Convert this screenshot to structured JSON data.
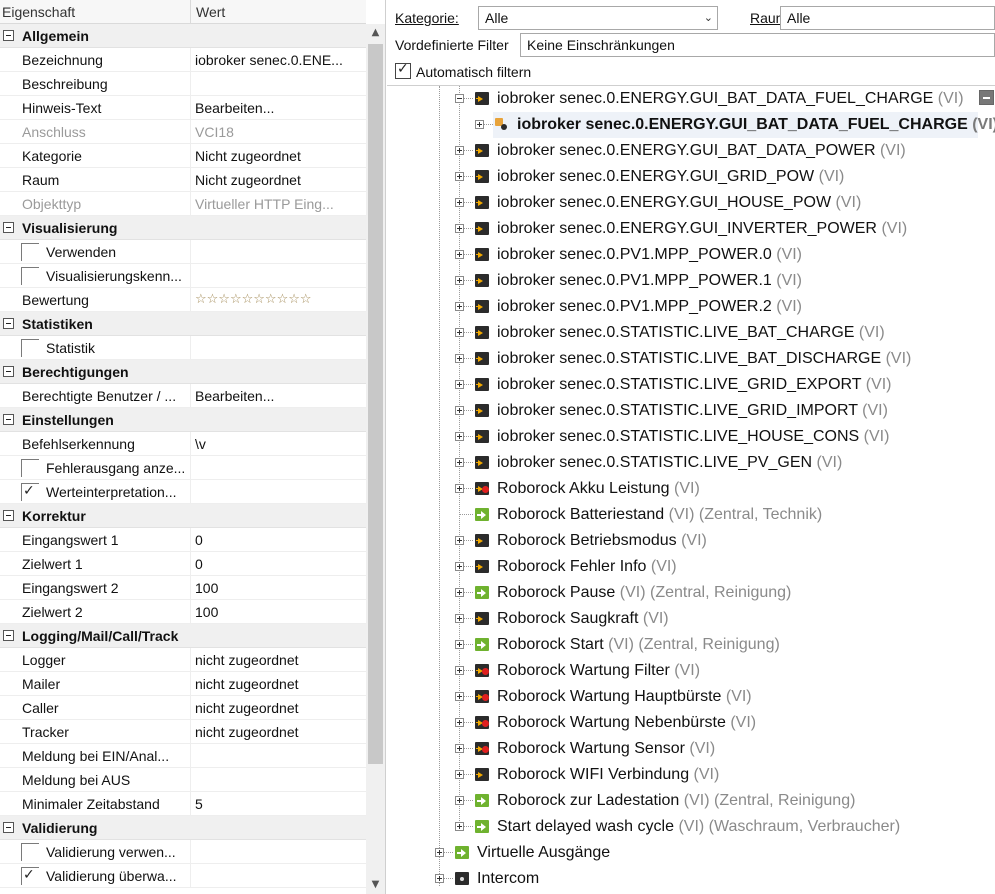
{
  "property_grid": {
    "header": {
      "col_property": "Eigenschaft",
      "col_value": "Wert"
    },
    "sections": [
      {
        "title": "Allgemein",
        "rows": [
          {
            "name": "Bezeichnung",
            "value": "iobroker senec.0.ENE..."
          },
          {
            "name": "Beschreibung",
            "value": ""
          },
          {
            "name": "Hinweis-Text",
            "value": "Bearbeiten..."
          },
          {
            "name": "Anschluss",
            "value": "VCI18",
            "disabled": true
          },
          {
            "name": "Kategorie",
            "value": "Nicht zugeordnet"
          },
          {
            "name": "Raum",
            "value": "Nicht zugeordnet"
          },
          {
            "name": "Objekttyp",
            "value": "Virtueller HTTP Eing...",
            "disabled": true
          }
        ]
      },
      {
        "title": "Visualisierung",
        "rows": [
          {
            "name": "Verwenden",
            "value": "",
            "checkbox": true,
            "checked": false
          },
          {
            "name": "Visualisierungskenn...",
            "value": "",
            "checkbox": true,
            "checked": false
          },
          {
            "name": "Bewertung",
            "value": "☆☆☆☆☆☆☆☆☆☆",
            "stars": true
          }
        ]
      },
      {
        "title": "Statistiken",
        "rows": [
          {
            "name": "Statistik",
            "value": "",
            "checkbox": true,
            "checked": false
          }
        ]
      },
      {
        "title": "Berechtigungen",
        "rows": [
          {
            "name": "Berechtigte Benutzer / ...",
            "value": "Bearbeiten..."
          }
        ]
      },
      {
        "title": "Einstellungen",
        "rows": [
          {
            "name": "Befehlserkennung",
            "value": "\\v"
          },
          {
            "name": "Fehlerausgang anze...",
            "value": "",
            "checkbox": true,
            "checked": false
          },
          {
            "name": "Werteinterpretation...",
            "value": "",
            "checkbox": true,
            "checked": true
          }
        ]
      },
      {
        "title": "Korrektur",
        "rows": [
          {
            "name": "Eingangswert 1",
            "value": "0"
          },
          {
            "name": "Zielwert 1",
            "value": "0"
          },
          {
            "name": "Eingangswert 2",
            "value": "100"
          },
          {
            "name": "Zielwert 2",
            "value": "100"
          }
        ]
      },
      {
        "title": "Logging/Mail/Call/Track",
        "rows": [
          {
            "name": "Logger",
            "value": "nicht zugeordnet"
          },
          {
            "name": "Mailer",
            "value": "nicht zugeordnet"
          },
          {
            "name": "Caller",
            "value": "nicht zugeordnet"
          },
          {
            "name": "Tracker",
            "value": "nicht zugeordnet"
          },
          {
            "name": "Meldung bei EIN/Anal...",
            "value": ""
          },
          {
            "name": "Meldung bei AUS",
            "value": ""
          },
          {
            "name": "Minimaler Zeitabstand",
            "value": "5"
          }
        ]
      },
      {
        "title": "Validierung",
        "rows": [
          {
            "name": "Validierung verwen...",
            "value": "",
            "checkbox": true,
            "checked": false
          },
          {
            "name": "Validierung überwa...",
            "value": "",
            "checkbox": true,
            "checked": true
          }
        ]
      }
    ]
  },
  "filters": {
    "category_label": "Kategorie:",
    "category_value": "Alle",
    "room_label": "Raum:",
    "room_value": "Alle",
    "predefined_label": "Vordefinierte Filter",
    "predefined_value": "Keine Einschränkungen",
    "autofilter_label": "Automatisch filtern"
  },
  "tree": {
    "items": [
      {
        "name": "iobroker senec.0.ENERGY.GUI_BAT_DATA_FUEL_CHARGE",
        "vi": "(VI)",
        "extra": "",
        "icon": "dark",
        "level": 1,
        "exp": "minus"
      },
      {
        "name": "iobroker senec.0.ENERGY.GUI_BAT_DATA_FUEL_CHARGE",
        "vi": "(VI)",
        "extra": "",
        "icon": "link",
        "level": 2,
        "exp": "plus",
        "bold": true
      },
      {
        "name": "iobroker senec.0.ENERGY.GUI_BAT_DATA_POWER",
        "vi": "(VI)",
        "extra": "",
        "icon": "dark",
        "level": 1,
        "exp": "plus"
      },
      {
        "name": "iobroker senec.0.ENERGY.GUI_GRID_POW",
        "vi": "(VI)",
        "extra": "",
        "icon": "dark",
        "level": 1,
        "exp": "plus"
      },
      {
        "name": "iobroker senec.0.ENERGY.GUI_HOUSE_POW",
        "vi": "(VI)",
        "extra": "",
        "icon": "dark",
        "level": 1,
        "exp": "plus"
      },
      {
        "name": "iobroker senec.0.ENERGY.GUI_INVERTER_POWER",
        "vi": "(VI)",
        "extra": "",
        "icon": "dark",
        "level": 1,
        "exp": "plus"
      },
      {
        "name": "iobroker senec.0.PV1.MPP_POWER.0",
        "vi": "(VI)",
        "extra": "",
        "icon": "dark",
        "level": 1,
        "exp": "plus"
      },
      {
        "name": "iobroker senec.0.PV1.MPP_POWER.1",
        "vi": "(VI)",
        "extra": "",
        "icon": "dark",
        "level": 1,
        "exp": "plus"
      },
      {
        "name": "iobroker senec.0.PV1.MPP_POWER.2",
        "vi": "(VI)",
        "extra": "",
        "icon": "dark",
        "level": 1,
        "exp": "plus"
      },
      {
        "name": "iobroker senec.0.STATISTIC.LIVE_BAT_CHARGE",
        "vi": "(VI)",
        "extra": "",
        "icon": "dark",
        "level": 1,
        "exp": "plus"
      },
      {
        "name": "iobroker senec.0.STATISTIC.LIVE_BAT_DISCHARGE",
        "vi": "(VI)",
        "extra": "",
        "icon": "dark",
        "level": 1,
        "exp": "plus"
      },
      {
        "name": "iobroker senec.0.STATISTIC.LIVE_GRID_EXPORT",
        "vi": "(VI)",
        "extra": "",
        "icon": "dark",
        "level": 1,
        "exp": "plus"
      },
      {
        "name": "iobroker senec.0.STATISTIC.LIVE_GRID_IMPORT",
        "vi": "(VI)",
        "extra": "",
        "icon": "dark",
        "level": 1,
        "exp": "plus"
      },
      {
        "name": "iobroker senec.0.STATISTIC.LIVE_HOUSE_CONS",
        "vi": "(VI)",
        "extra": "",
        "icon": "dark",
        "level": 1,
        "exp": "plus"
      },
      {
        "name": "iobroker senec.0.STATISTIC.LIVE_PV_GEN",
        "vi": "(VI)",
        "extra": "",
        "icon": "dark",
        "level": 1,
        "exp": "plus"
      },
      {
        "name": "Roborock Akku Leistung",
        "vi": "(VI)",
        "extra": "",
        "icon": "dark",
        "level": 1,
        "exp": "plus",
        "reddot": true
      },
      {
        "name": "Roborock Batteriestand",
        "vi": "(VI)",
        "extra": "(Zentral, Technik)",
        "icon": "green",
        "level": 1,
        "exp": "none"
      },
      {
        "name": "Roborock Betriebsmodus",
        "vi": "(VI)",
        "extra": "",
        "icon": "dark",
        "level": 1,
        "exp": "plus"
      },
      {
        "name": "Roborock Fehler Info",
        "vi": "(VI)",
        "extra": "",
        "icon": "dark",
        "level": 1,
        "exp": "plus"
      },
      {
        "name": "Roborock Pause",
        "vi": "(VI)",
        "extra": "(Zentral, Reinigung)",
        "icon": "green",
        "level": 1,
        "exp": "plus"
      },
      {
        "name": "Roborock Saugkraft",
        "vi": "(VI)",
        "extra": "",
        "icon": "dark",
        "level": 1,
        "exp": "plus"
      },
      {
        "name": "Roborock Start",
        "vi": "(VI)",
        "extra": "(Zentral, Reinigung)",
        "icon": "green",
        "level": 1,
        "exp": "plus"
      },
      {
        "name": "Roborock Wartung Filter",
        "vi": "(VI)",
        "extra": "",
        "icon": "dark",
        "level": 1,
        "exp": "plus",
        "reddot": true
      },
      {
        "name": "Roborock Wartung Hauptbürste",
        "vi": "(VI)",
        "extra": "",
        "icon": "dark",
        "level": 1,
        "exp": "plus",
        "reddot": true
      },
      {
        "name": "Roborock Wartung Nebenbürste",
        "vi": "(VI)",
        "extra": "",
        "icon": "dark",
        "level": 1,
        "exp": "plus",
        "reddot": true
      },
      {
        "name": "Roborock Wartung Sensor",
        "vi": "(VI)",
        "extra": "",
        "icon": "dark",
        "level": 1,
        "exp": "plus",
        "reddot": true
      },
      {
        "name": "Roborock WIFI Verbindung",
        "vi": "(VI)",
        "extra": "",
        "icon": "dark",
        "level": 1,
        "exp": "plus"
      },
      {
        "name": "Roborock zur Ladestation",
        "vi": "(VI)",
        "extra": "(Zentral, Reinigung)",
        "icon": "green",
        "level": 1,
        "exp": "plus"
      },
      {
        "name": "Start delayed wash cycle",
        "vi": "(VI)",
        "extra": "(Waschraum, Verbraucher)",
        "icon": "green",
        "level": 1,
        "exp": "plus"
      },
      {
        "name": "Virtuelle Ausgänge",
        "vi": "",
        "extra": "",
        "icon": "green",
        "level": 0,
        "exp": "plus"
      },
      {
        "name": "Intercom",
        "vi": "",
        "extra": "",
        "icon": "intercom",
        "level": 0,
        "exp": "plus"
      }
    ]
  },
  "colors": {
    "category_bg": "#f0f0f0",
    "icon_orange": "#f2a900",
    "icon_green": "#6fb22f",
    "alert_red": "#e02020"
  }
}
